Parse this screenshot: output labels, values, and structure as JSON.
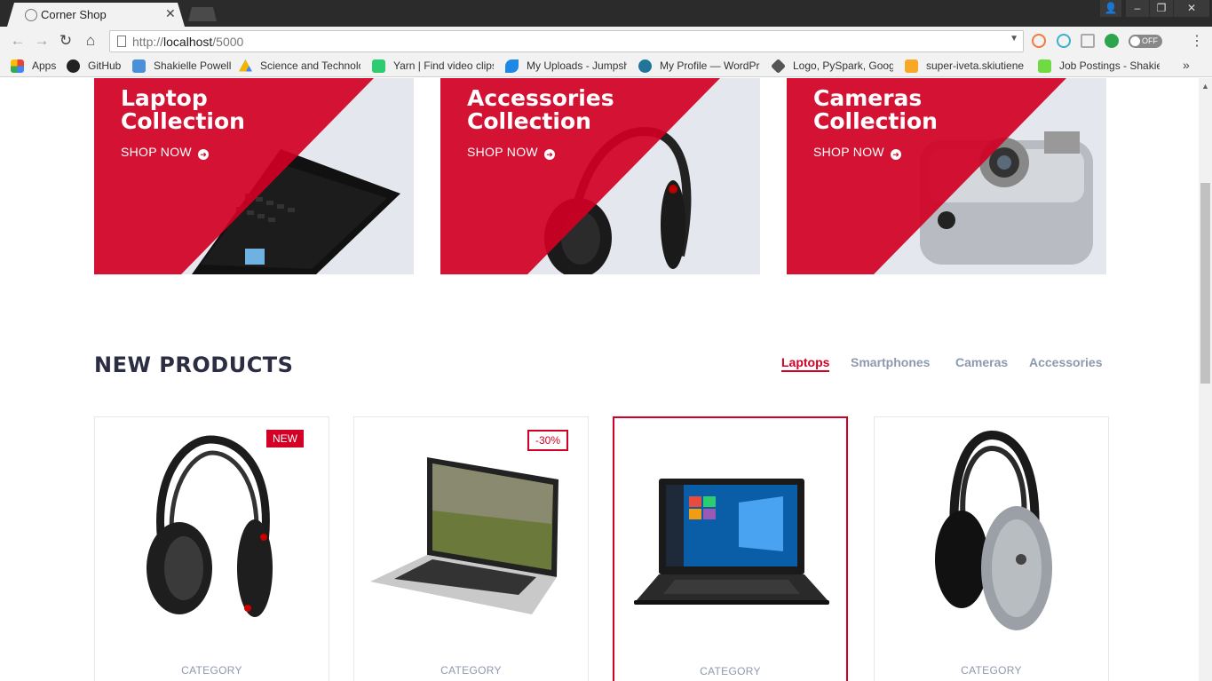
{
  "browser": {
    "tab_title": "Corner Shop",
    "url_scheme": "http://",
    "url_host": "localhost",
    "url_rest": "/5000",
    "extension_toggle": "OFF",
    "bookmarks": [
      {
        "label": "Apps",
        "icon": "apps-grid-icon",
        "color": "#e94335"
      },
      {
        "label": "GitHub",
        "icon": "github-icon",
        "color": "#222222"
      },
      {
        "label": "Shakielle Powell",
        "icon": "cloud-icon",
        "color": "#4a90d9"
      },
      {
        "label": "Science and Technolo",
        "icon": "drive-icon",
        "color": "#f4b400"
      },
      {
        "label": "Yarn | Find video clips",
        "icon": "yarn-icon",
        "color": "#2ecc71"
      },
      {
        "label": "My Uploads - Jumpsh",
        "icon": "jumpshare-icon",
        "color": "#1e88e5"
      },
      {
        "label": "My Profile — WordPr",
        "icon": "wordpress-icon",
        "color": "#21759b"
      },
      {
        "label": "Logo, PySpark, Googl",
        "icon": "diamond-icon",
        "color": "#555555"
      },
      {
        "label": "super-iveta.skiutiene",
        "icon": "bolt-icon",
        "color": "#f9a825"
      },
      {
        "label": "Job Postings - Shakie",
        "icon": "upwork-icon",
        "color": "#6fda44"
      }
    ]
  },
  "collections": [
    {
      "title1": "Laptop",
      "title2": "Collection",
      "cta": "SHOP NOW"
    },
    {
      "title1": "Accessories",
      "title2": "Collection",
      "cta": "SHOP NOW"
    },
    {
      "title1": "Cameras",
      "title2": "Collection",
      "cta": "SHOP NOW"
    }
  ],
  "new_products": {
    "title": "NEW PRODUCTS",
    "tabs": [
      "Laptops",
      "Smartphones",
      "Cameras",
      "Accessories"
    ],
    "active_tab": "Laptops",
    "cards": [
      {
        "badge": "NEW",
        "category": "CATEGORY",
        "image": "headphones-image"
      },
      {
        "badge": "-30%",
        "category": "CATEGORY",
        "image": "laptop-silver-image"
      },
      {
        "badge": "",
        "category": "CATEGORY",
        "image": "laptop-black-image"
      },
      {
        "badge": "",
        "category": "CATEGORY",
        "image": "headphones-silver-image"
      }
    ]
  },
  "colors": {
    "accent": "#d10024",
    "heading": "#2b2d42",
    "muted": "#8d99ae"
  }
}
